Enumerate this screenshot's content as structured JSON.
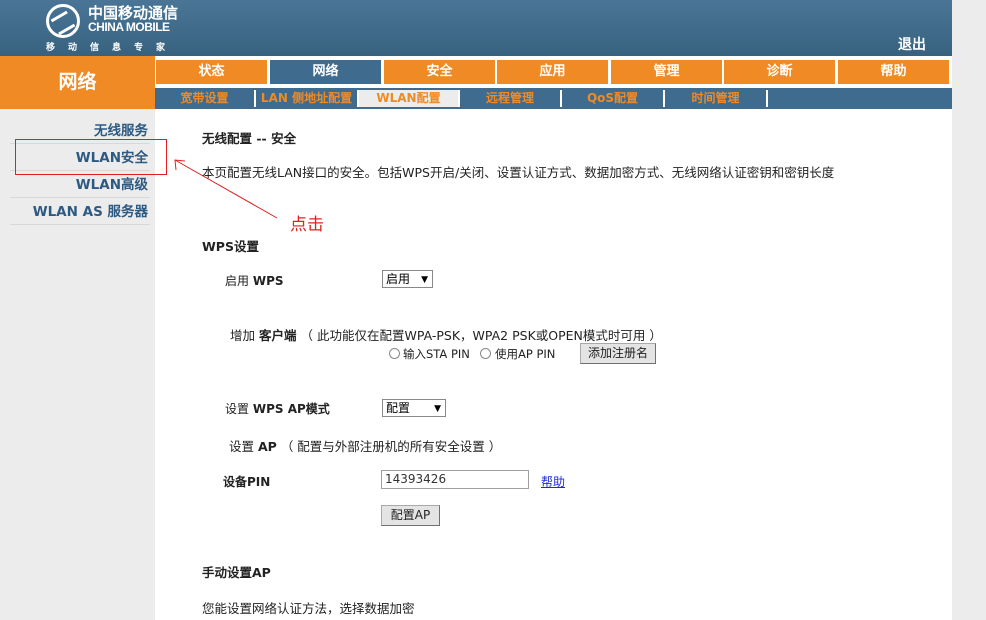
{
  "header": {
    "logo_cn": "中国移动通信",
    "logo_en": "CHINA MOBILE",
    "logo_slogan": "移动信息专家",
    "logout_label": "退出"
  },
  "section_title": "网络",
  "tabs": [
    "状态",
    "网络",
    "安全",
    "应用",
    "管理",
    "诊断",
    "帮助"
  ],
  "active_tab_index": 1,
  "subtabs": [
    "宽带设置",
    "LAN 侧地址配置",
    "WLAN配置",
    "远程管理",
    "QoS配置",
    "时间管理"
  ],
  "active_subtab_index": 2,
  "sidebar": {
    "items": [
      {
        "label": "无线服务"
      },
      {
        "label": "WLAN安全"
      },
      {
        "label": "WLAN高级"
      },
      {
        "label": "WLAN AS 服务器"
      }
    ]
  },
  "annotation": {
    "label": "点击"
  },
  "content": {
    "heading": "无线配置 -- 安全",
    "description": "本页配置无线LAN接口的安全。包括WPS开启/关闭、设置认证方式、数据加密方式、无线网络认证密钥和密钥长度",
    "wps_heading": "WPS设置",
    "enable_wps_label_pre": "启用",
    "enable_wps_label_bold": "WPS",
    "enable_wps_value": "启用",
    "add_client_pre": "增加",
    "add_client_bold": "客户端",
    "add_client_note": "（ 此功能仅在配置WPA-PSK，WPA2 PSK或OPEN模式时可用 ）",
    "radio_sta_pin": "输入STA PIN",
    "radio_ap_pin": "使用AP PIN",
    "add_registrar_button": "添加注册名",
    "wps_ap_mode_pre": "设置",
    "wps_ap_mode_bold": "WPS AP模式",
    "wps_ap_mode_value": "配置",
    "setup_ap_pre": "设置",
    "setup_ap_bold": "AP",
    "setup_ap_note": "（ 配置与外部注册机的所有安全设置 ）",
    "device_pin_label": "设备PIN",
    "device_pin_value": "14393426",
    "help_link": "帮助",
    "config_ap_button": "配置AP",
    "manual_ap_heading": "手动设置AP",
    "manual_ap_desc": "您能设置网络认证方法，选择数据加密"
  }
}
